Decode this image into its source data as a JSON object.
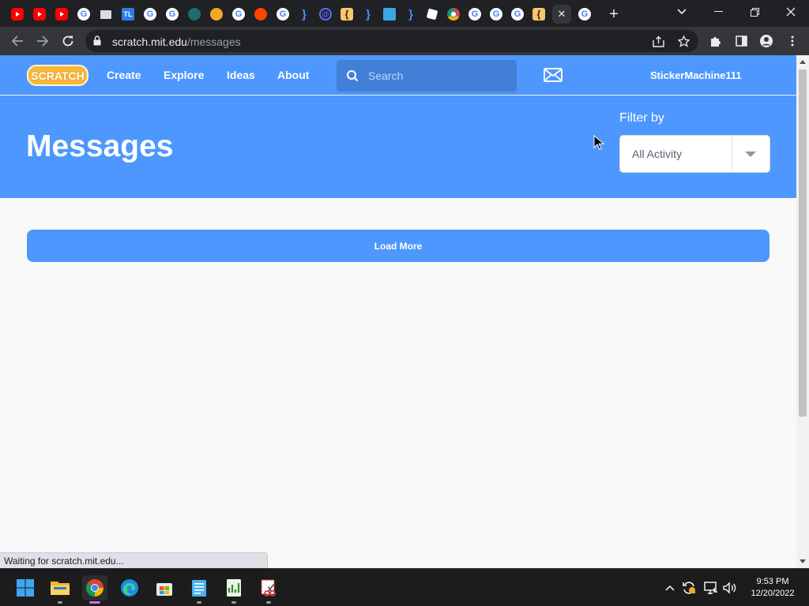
{
  "browser": {
    "tabs": [
      {
        "icon": "youtube-icon",
        "kind": "yt",
        "glyph": ""
      },
      {
        "icon": "youtube-icon",
        "kind": "yt",
        "glyph": ""
      },
      {
        "icon": "youtube-icon",
        "kind": "yt",
        "glyph": ""
      },
      {
        "icon": "google-icon",
        "kind": "g",
        "glyph": "G"
      },
      {
        "icon": "monitor-icon",
        "kind": "mon",
        "glyph": ""
      },
      {
        "icon": "tl-icon",
        "kind": "tl",
        "glyph": "TL"
      },
      {
        "icon": "google-icon",
        "kind": "g",
        "glyph": "G"
      },
      {
        "icon": "google-icon",
        "kind": "g",
        "glyph": "G"
      },
      {
        "icon": "wave-icon",
        "kind": "wave",
        "glyph": ""
      },
      {
        "icon": "orange-circle-icon",
        "kind": "orange",
        "glyph": ""
      },
      {
        "icon": "google-icon",
        "kind": "g",
        "glyph": "G"
      },
      {
        "icon": "reddit-icon",
        "kind": "reddit",
        "glyph": ""
      },
      {
        "icon": "google-icon",
        "kind": "g",
        "glyph": "G"
      },
      {
        "icon": "brace-icon",
        "kind": "brace",
        "glyph": "}"
      },
      {
        "icon": "at-sign-icon",
        "kind": "ring",
        "glyph": "@"
      },
      {
        "icon": "bracket-icon",
        "kind": "bracket",
        "glyph": "{"
      },
      {
        "icon": "brace-icon",
        "kind": "brace",
        "glyph": "}"
      },
      {
        "icon": "screen-icon",
        "kind": "screen",
        "glyph": ""
      },
      {
        "icon": "brace-icon",
        "kind": "brace",
        "glyph": "}"
      },
      {
        "icon": "roblox-icon",
        "kind": "roblox",
        "glyph": ""
      },
      {
        "icon": "chrome-icon",
        "kind": "chrome",
        "glyph": ""
      },
      {
        "icon": "google-icon",
        "kind": "g",
        "glyph": "G"
      },
      {
        "icon": "google-icon",
        "kind": "g",
        "glyph": "G"
      },
      {
        "icon": "google-icon",
        "kind": "g",
        "glyph": "G"
      },
      {
        "icon": "bracket-icon",
        "kind": "bracket",
        "glyph": "{"
      },
      {
        "icon": "close-icon",
        "kind": "close",
        "glyph": "✕",
        "active": true
      },
      {
        "icon": "google-icon",
        "kind": "g",
        "glyph": "G"
      }
    ],
    "url_host": "scratch.mit.edu",
    "url_path": "/messages"
  },
  "scratch": {
    "logo_text": "SCRATCH",
    "nav": [
      "Create",
      "Explore",
      "Ideas",
      "About"
    ],
    "search_placeholder": "Search",
    "username": "StickerMachine111",
    "page_title": "Messages",
    "filter_label": "Filter by",
    "filter_value": "All Activity",
    "load_more": "Load More"
  },
  "status_text": "Waiting for scratch.mit.edu...",
  "taskbar": {
    "apps": [
      "windows-start-icon",
      "file-explorer-icon",
      "chrome-icon",
      "edge-icon",
      "store-icon",
      "notepad-icon",
      "spreadsheet-icon",
      "snipping-icon"
    ],
    "time": "9:53 PM",
    "date": "12/20/2022"
  },
  "colors": {
    "scratch_blue": "#4d97ff",
    "chrome_dark": "#202124"
  }
}
